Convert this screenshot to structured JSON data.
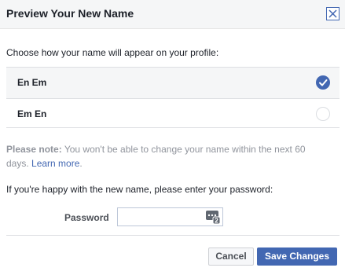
{
  "dialog": {
    "title": "Preview Your New Name",
    "close_icon": "close-icon"
  },
  "prompt": "Choose how your name will appear on your profile:",
  "options": [
    {
      "label": "En Em",
      "selected": true
    },
    {
      "label": "Em En",
      "selected": false
    }
  ],
  "note": {
    "strong": "Please note:",
    "text": " You won't be able to change your name within the next 60 days. ",
    "link": "Learn more",
    "tail": "."
  },
  "password_prompt": "If you're happy with the new name, please enter your password:",
  "password": {
    "label": "Password",
    "value": "",
    "icon": "password-manager-icon"
  },
  "buttons": {
    "cancel": "Cancel",
    "save": "Save Changes"
  },
  "colors": {
    "accent": "#4267b2",
    "header_bg": "#f5f6f7",
    "note_text": "#90949c"
  }
}
